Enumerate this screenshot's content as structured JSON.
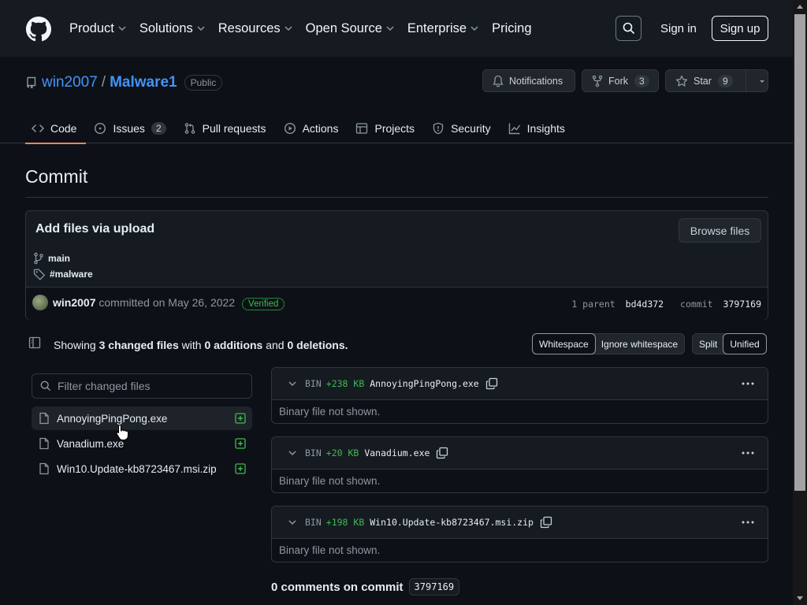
{
  "header": {
    "nav": [
      {
        "label": "Product",
        "dropdown": true
      },
      {
        "label": "Solutions",
        "dropdown": true
      },
      {
        "label": "Resources",
        "dropdown": true
      },
      {
        "label": "Open Source",
        "dropdown": true
      },
      {
        "label": "Enterprise",
        "dropdown": true
      },
      {
        "label": "Pricing",
        "dropdown": false
      }
    ],
    "sign_in": "Sign in",
    "sign_up": "Sign up"
  },
  "repo": {
    "owner": "win2007",
    "separator": "/",
    "name": "Malware1",
    "visibility": "Public",
    "notifications": "Notifications",
    "fork_label": "Fork",
    "fork_count": "3",
    "star_label": "Star",
    "star_count": "9"
  },
  "tabs": [
    {
      "label": "Code",
      "icon": "code-icon",
      "active": true,
      "count": ""
    },
    {
      "label": "Issues",
      "icon": "issue-icon",
      "active": false,
      "count": "2"
    },
    {
      "label": "Pull requests",
      "icon": "pull-request-icon",
      "active": false,
      "count": ""
    },
    {
      "label": "Actions",
      "icon": "play-icon",
      "active": false,
      "count": ""
    },
    {
      "label": "Projects",
      "icon": "table-icon",
      "active": false,
      "count": ""
    },
    {
      "label": "Security",
      "icon": "shield-icon",
      "active": false,
      "count": ""
    },
    {
      "label": "Insights",
      "icon": "graph-icon",
      "active": false,
      "count": ""
    }
  ],
  "page_title": "Commit",
  "commit": {
    "message": "Add files via upload",
    "browse_files": "Browse files",
    "branch": "main",
    "tag": "#malware",
    "author": "win2007",
    "committed_text": "committed on May 26, 2022",
    "verified": "Verified",
    "parent_label": "1 parent",
    "parent_sha": "bd4d372",
    "commit_label": "commit",
    "commit_sha": "3797169"
  },
  "summary": {
    "showing": "Showing",
    "changed_count": "3",
    "changed_files": "changed files",
    "with": "with",
    "additions": "0 additions",
    "and": "and",
    "deletions": "0 deletions.",
    "whitespace": "Whitespace",
    "ignore_whitespace": "Ignore whitespace",
    "split": "Split",
    "unified": "Unified"
  },
  "file_tree": {
    "filter_placeholder": "Filter changed files",
    "files": [
      {
        "name": "AnnoyingPingPong.exe",
        "selected": true
      },
      {
        "name": "Vanadium.exe",
        "selected": false
      },
      {
        "name": "Win10.Update-kb8723467.msi.zip",
        "selected": false
      }
    ]
  },
  "diffs": [
    {
      "type": "BIN",
      "size": "+238 KB",
      "filename": "AnnoyingPingPong.exe",
      "body": "Binary file not shown."
    },
    {
      "type": "BIN",
      "size": "+20 KB",
      "filename": "Vanadium.exe",
      "body": "Binary file not shown."
    },
    {
      "type": "BIN",
      "size": "+198 KB",
      "filename": "Win10.Update-kb8723467.msi.zip",
      "body": "Binary file not shown."
    }
  ],
  "comments": {
    "label": "0 comments on commit",
    "sha": "3797169"
  },
  "colors": {
    "background": "#0d1117",
    "header": "#161b22",
    "link": "#4493f8",
    "added": "#3fb950",
    "active_tab": "#f78166"
  }
}
